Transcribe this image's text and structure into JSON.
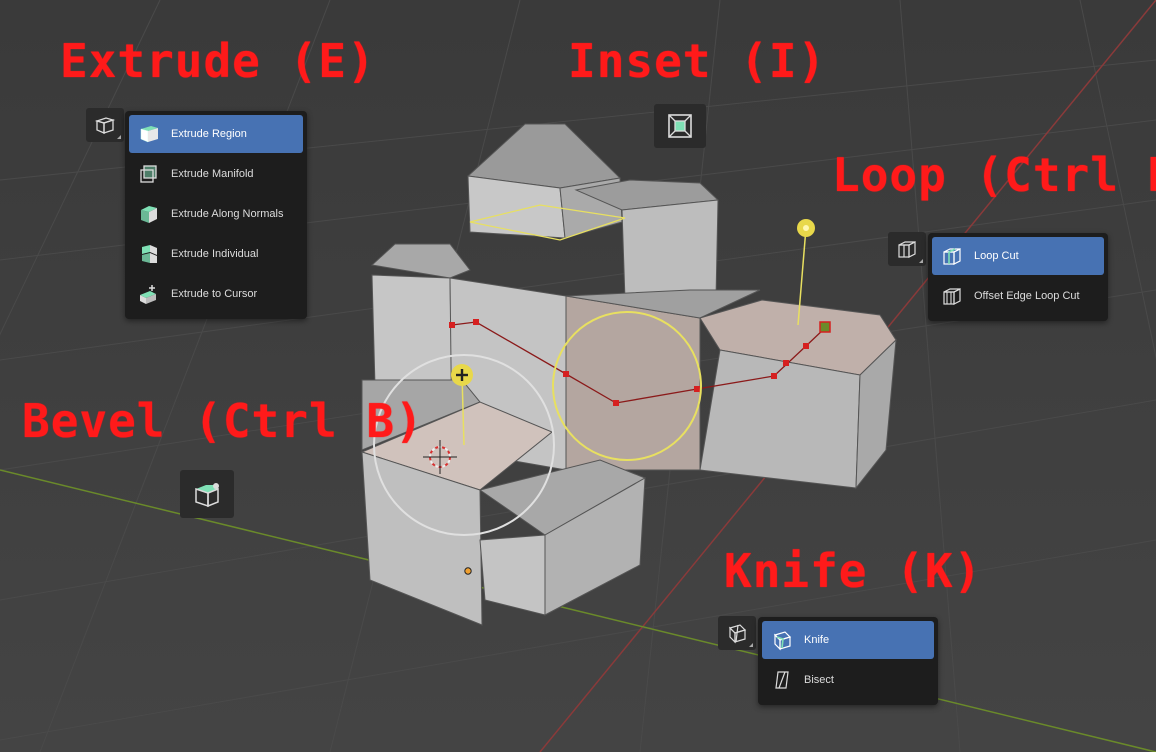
{
  "labels": {
    "extrude": "Extrude (E)",
    "inset": "Inset (I)",
    "loop": "Loop (Ctrl R)",
    "bevel": "Bevel (Ctrl B)",
    "knife": "Knife (K)"
  },
  "extrude_menu": {
    "items": [
      {
        "label": "Extrude Region",
        "icon": "extrude-region-icon",
        "active": true
      },
      {
        "label": "Extrude Manifold",
        "icon": "extrude-manifold-icon"
      },
      {
        "label": "Extrude Along Normals",
        "icon": "extrude-normals-icon"
      },
      {
        "label": "Extrude Individual",
        "icon": "extrude-individual-icon"
      },
      {
        "label": "Extrude to Cursor",
        "icon": "extrude-cursor-icon"
      }
    ]
  },
  "loop_menu": {
    "items": [
      {
        "label": "Loop Cut",
        "icon": "loop-cut-icon",
        "active": true
      },
      {
        "label": "Offset Edge Loop Cut",
        "icon": "offset-edge-loop-icon"
      }
    ]
  },
  "knife_menu": {
    "items": [
      {
        "label": "Knife",
        "icon": "knife-icon",
        "active": true
      },
      {
        "label": "Bisect",
        "icon": "bisect-icon"
      }
    ]
  },
  "colors": {
    "label_red": "#ff1a1a",
    "menu_bg": "#1d1d1d",
    "highlight": "#4772b3",
    "icon_green": "#7fe0b5",
    "viewport_bg": "#3d3d3d"
  }
}
